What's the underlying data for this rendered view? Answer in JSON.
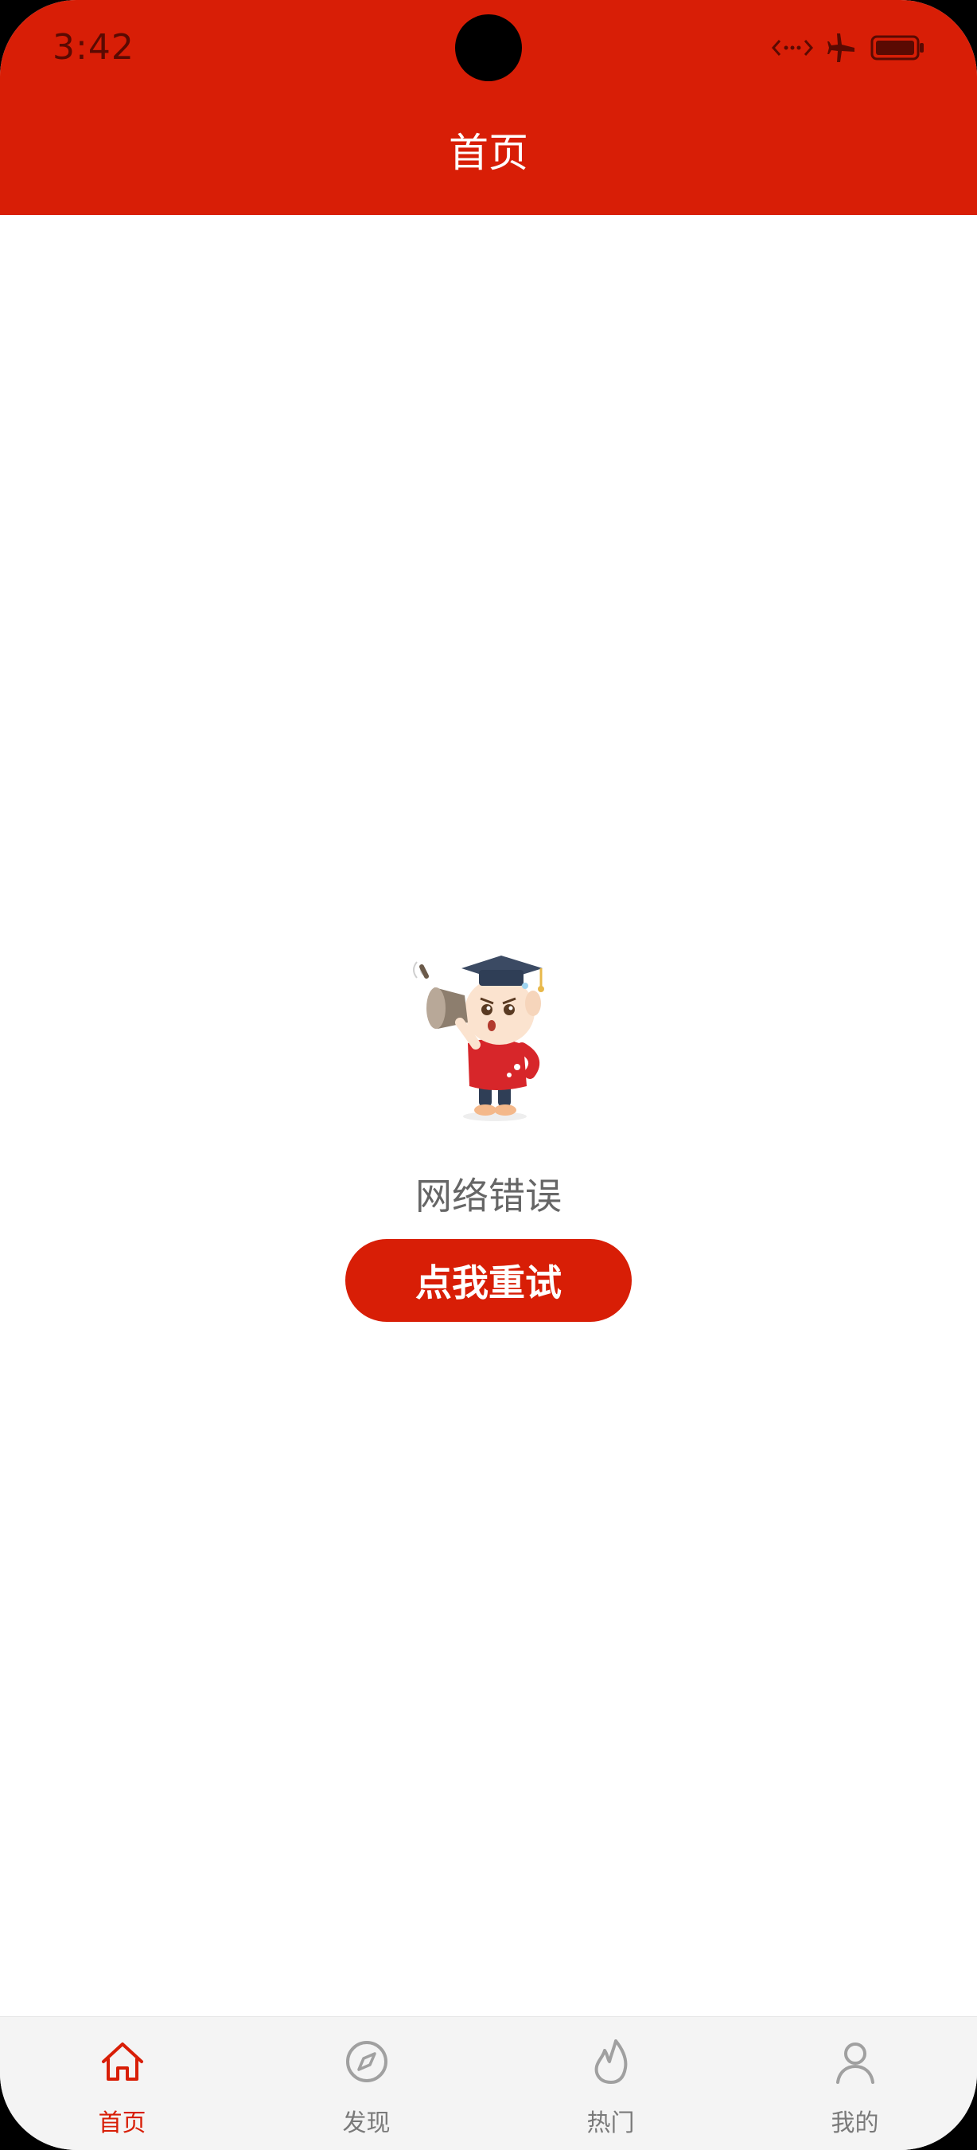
{
  "status_bar": {
    "time": "3:42",
    "icons": [
      "data-transfer-icon",
      "airplane-mode-icon",
      "battery-icon"
    ]
  },
  "header": {
    "title": "首页"
  },
  "error_state": {
    "message": "网络错误",
    "retry_label": "点我重试",
    "illustration": "mascot-sheep-with-megaphone"
  },
  "tabbar": {
    "items": [
      {
        "label": "首页",
        "icon": "home-icon",
        "active": true
      },
      {
        "label": "发现",
        "icon": "compass-icon",
        "active": false
      },
      {
        "label": "热门",
        "icon": "flame-icon",
        "active": false
      },
      {
        "label": "我的",
        "icon": "user-icon",
        "active": false
      }
    ]
  },
  "colors": {
    "brand": "#d81e06",
    "inactive": "#7a7a7a",
    "tabbar_bg": "#f4f4f4",
    "text_gray": "#666666"
  }
}
